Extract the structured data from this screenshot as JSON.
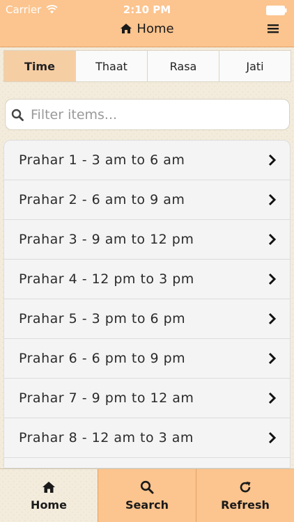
{
  "status_bar": {
    "carrier": "Carrier",
    "time": "2:10 PM"
  },
  "nav": {
    "title": "Home",
    "icon": "home-icon",
    "menu_icon": "hamburger-menu-icon"
  },
  "tabs": [
    {
      "label": "Time",
      "active": true
    },
    {
      "label": "Thaat",
      "active": false
    },
    {
      "label": "Rasa",
      "active": false
    },
    {
      "label": "Jati",
      "active": false
    }
  ],
  "search": {
    "placeholder": "Filter items...",
    "value": ""
  },
  "list": {
    "items": [
      {
        "label": "Prahar 1 - 3 am to 6 am"
      },
      {
        "label": "Prahar 2 - 6 am to 9 am"
      },
      {
        "label": "Prahar 3 - 9 am to 12 pm"
      },
      {
        "label": "Prahar 4 - 12 pm to 3 pm"
      },
      {
        "label": "Prahar 5 - 3 pm to 6 pm"
      },
      {
        "label": "Prahar 6 - 6 pm to 9 pm"
      },
      {
        "label": "Prahar 7 - 9 pm to 12 am"
      },
      {
        "label": "Prahar 8 - 12 am to 3 am"
      }
    ]
  },
  "bottom_bar": [
    {
      "label": "Home",
      "icon": "home-icon"
    },
    {
      "label": "Search",
      "icon": "search-icon"
    },
    {
      "label": "Refresh",
      "icon": "refresh-icon"
    }
  ],
  "colors": {
    "accent": "#fcc48e",
    "active_tab": "#f6cea3",
    "background": "#f3ecdc"
  }
}
